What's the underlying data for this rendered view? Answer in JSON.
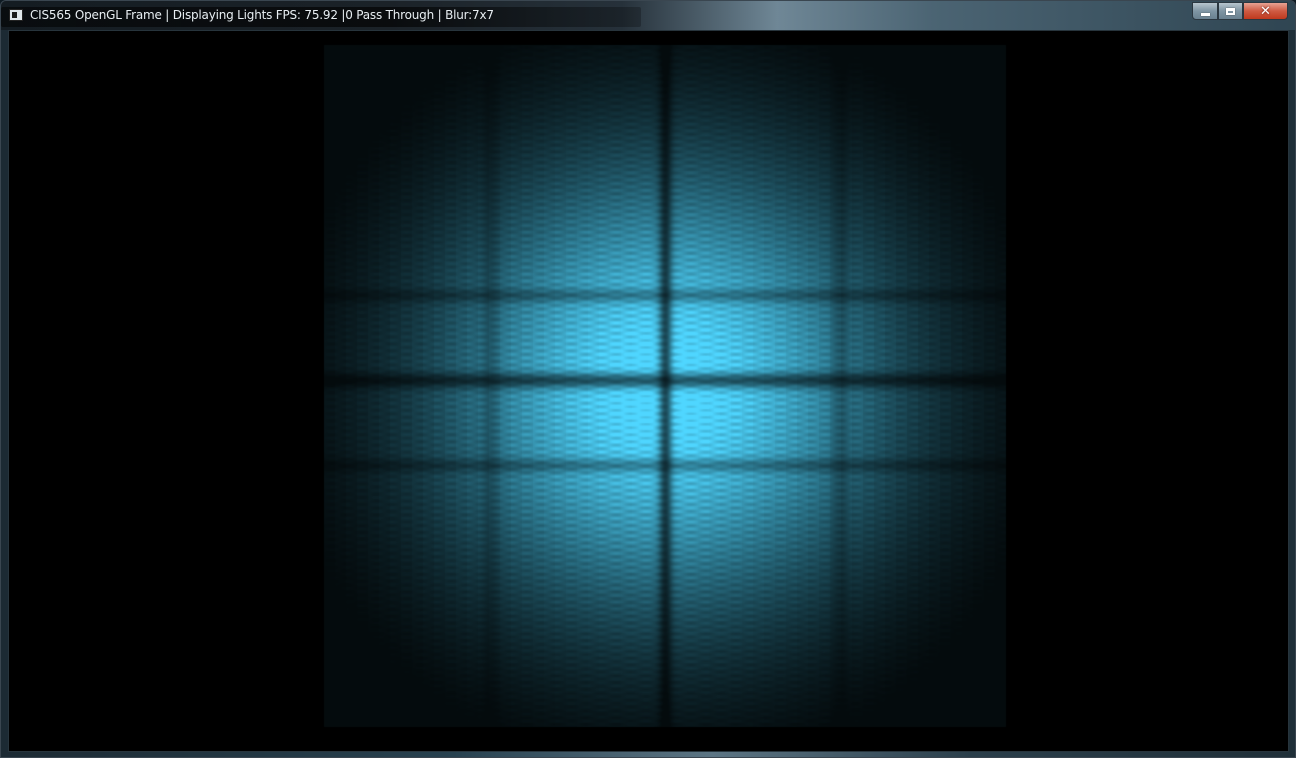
{
  "window": {
    "title": "CIS565 OpenGL Frame | Displaying Lights FPS: 75.92 |0 Pass Through | Blur:7x7",
    "icon": "app-window-icon",
    "controls": {
      "minimize": {
        "icon": "minimize-icon"
      },
      "maximize": {
        "icon": "maximize-icon"
      },
      "close": {
        "icon": "close-icon",
        "glyph": "✕"
      }
    }
  },
  "render": {
    "background_color": "#000000",
    "light_color": "#4fd6ff",
    "description_free": true
  }
}
